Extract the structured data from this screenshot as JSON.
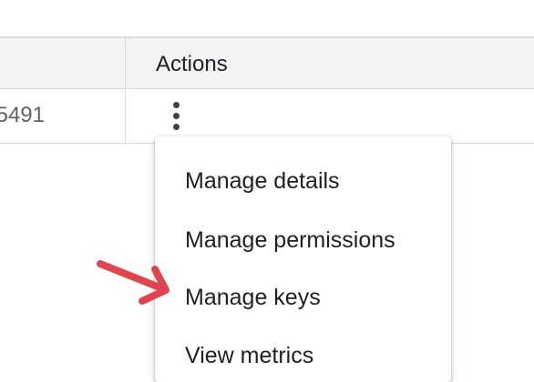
{
  "table": {
    "header": {
      "actions_label": "Actions"
    },
    "row": {
      "id_partial": "5491",
      "actions_icon": "more-vert-icon"
    }
  },
  "menu": {
    "items": [
      {
        "label": "Manage details"
      },
      {
        "label": "Manage permissions"
      },
      {
        "label": "Manage keys"
      },
      {
        "label": "View metrics"
      }
    ]
  },
  "annotation": {
    "arrow_color": "#e0454f",
    "points_to": "Manage keys"
  },
  "colors": {
    "header_bg": "#f1f3f4",
    "border": "#dadce0",
    "text": "#202124",
    "muted_text": "#5f6368"
  }
}
